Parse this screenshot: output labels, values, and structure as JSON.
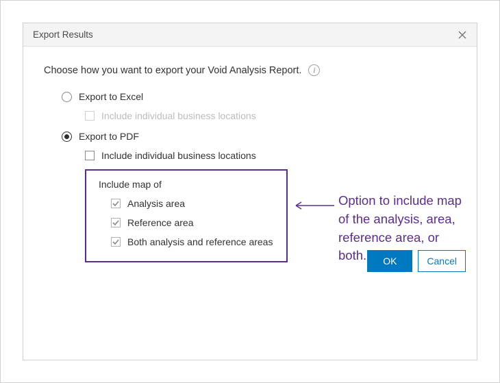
{
  "dialog": {
    "title": "Export Results",
    "prompt": "Choose how you want to export your Void Analysis Report.",
    "info_glyph": "i",
    "radio_excel": "Export to Excel",
    "radio_pdf": "Export to PDF",
    "chk_excel_locations": "Include individual business locations",
    "chk_pdf_locations": "Include individual business locations",
    "map_section_label": "Include map of",
    "chk_map_analysis": "Analysis area",
    "chk_map_reference": "Reference area",
    "chk_map_both": "Both analysis and reference areas",
    "btn_ok": "OK",
    "btn_cancel": "Cancel"
  },
  "callout": {
    "text": "Option to include map of the analysis, area, reference area, or both."
  },
  "colors": {
    "accent": "#0079c1",
    "highlight": "#5b2d8f"
  }
}
